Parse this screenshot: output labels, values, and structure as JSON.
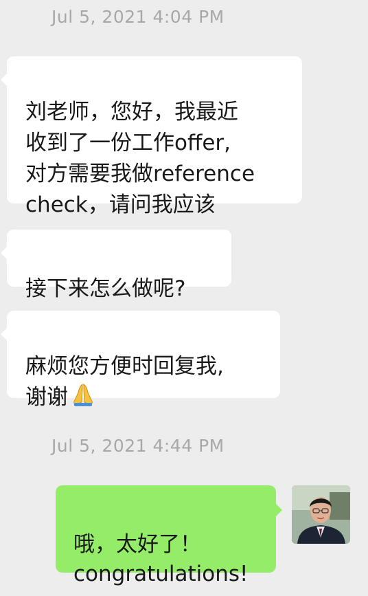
{
  "timestamps": {
    "first": "Jul 5, 2021 4:04 PM",
    "second": "Jul 5, 2021 4:44 PM"
  },
  "messages": [
    {
      "side": "left",
      "text": "刘老师，您好，我最近\n收到了一份工作offer,\n对方需要我做reference\ncheck，请问我应该"
    },
    {
      "side": "left",
      "text": "接下来怎么做呢?"
    },
    {
      "side": "left",
      "text": "麻烦您方便时回复我,\n谢谢",
      "emoji": "folded-hands-emoji"
    },
    {
      "side": "right",
      "text": "哦，太好了！\ncongratulations!"
    }
  ],
  "avatar": {
    "icon": "user-avatar-photo"
  },
  "colors": {
    "background": "#ededed",
    "incoming_bubble": "#ffffff",
    "outgoing_bubble": "#95ec69",
    "timestamp": "#a8a8a8"
  }
}
